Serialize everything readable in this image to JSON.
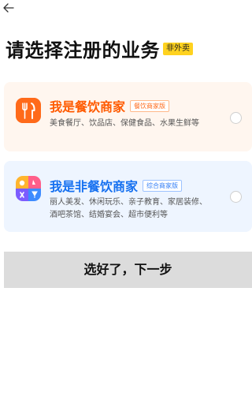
{
  "header": {
    "back_icon": "arrow-left-icon",
    "title": "请选择注册的业务",
    "tag": "非外卖"
  },
  "options": [
    {
      "icon": "fork-knife-icon",
      "title": "我是餐饮商家",
      "badge": "餐饮商家版",
      "description": "美食餐厅、饮品店、保健食品、水果生鲜等",
      "accent": "#ff5a00"
    },
    {
      "icon": "leisure-services-icon",
      "title": "我是非餐饮商家",
      "badge": "综合商家版",
      "description": "丽人美发、休闲玩乐、亲子教育、家居装修、酒吧茶馆、结婚宴会、超市便利等",
      "accent": "#1570f0"
    }
  ],
  "next_button": {
    "label": "选好了，下一步"
  }
}
